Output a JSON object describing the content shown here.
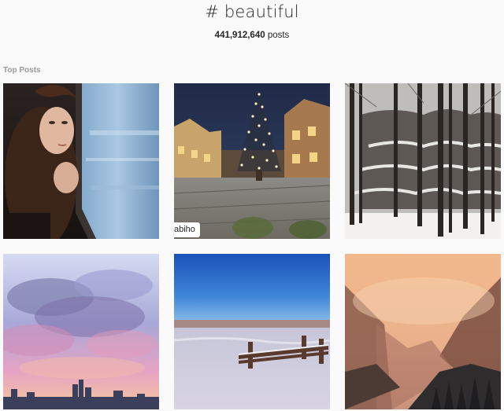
{
  "header": {
    "hashtag": "# beautiful",
    "post_count": "441,912,640",
    "post_count_suffix": " posts"
  },
  "section": {
    "title": "Top Posts"
  },
  "posts": [
    {
      "subject": "woman-by-train-window"
    },
    {
      "subject": "christmas-tree-town-square",
      "overlay_text": "abiho"
    },
    {
      "subject": "snowy-forest-rocks"
    },
    {
      "subject": "pastel-sky-clouds-city"
    },
    {
      "subject": "winter-beach-bench"
    },
    {
      "subject": "misty-mountain-valley"
    }
  ]
}
